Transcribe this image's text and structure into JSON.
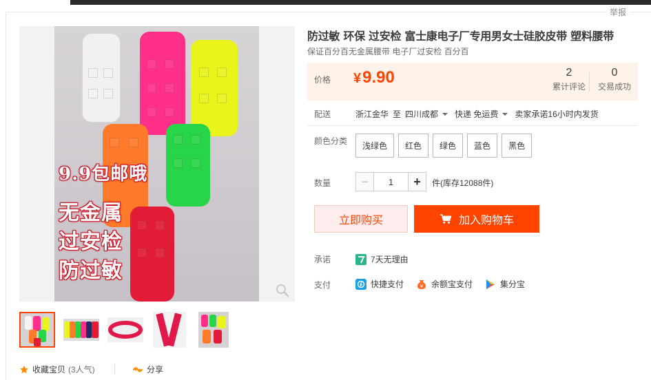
{
  "report_label": "举报",
  "product": {
    "title": "防过敏 环保 过安检 富士康电子厂专用男女士硅胶皮带 塑料腰带",
    "subtitle": "保证百分百无金属腰带 电子厂过安检 百分百"
  },
  "image": {
    "promo_lines": [
      "9.9包邮哦",
      "无金属",
      "过安检",
      "防过敏"
    ]
  },
  "price": {
    "label": "价格",
    "currency": "¥",
    "value": "9.90",
    "reviews_count": "2",
    "reviews_label": "累计评论",
    "trades_count": "0",
    "trades_label": "交易成功"
  },
  "shipping": {
    "label": "配送",
    "from": "浙江金华",
    "to_label": "至",
    "to": "四川成都",
    "method": "快递 免运费",
    "promise": "卖家承诺16小时内发货"
  },
  "sku": {
    "label": "颜色分类",
    "options": [
      "浅绿色",
      "红色",
      "绿色",
      "蓝色",
      "黑色"
    ]
  },
  "quantity": {
    "label": "数量",
    "value": "1",
    "minus": "−",
    "plus": "+",
    "stock": "件(库存12088件)"
  },
  "actions": {
    "buy_now": "立即购买",
    "add_cart": "加入购物车"
  },
  "service": {
    "label": "承诺",
    "item": "7天无理由"
  },
  "payment": {
    "label": "支付",
    "methods": [
      "快捷支付",
      "余额宝支付",
      "集分宝"
    ]
  },
  "footer": {
    "favorite": "收藏宝贝",
    "popularity": "(3人气)",
    "share": "分享"
  },
  "colors": {
    "accent": "#ff4400",
    "price_bg": "#fff2e8",
    "buy_now_bg": "#ffeded"
  }
}
